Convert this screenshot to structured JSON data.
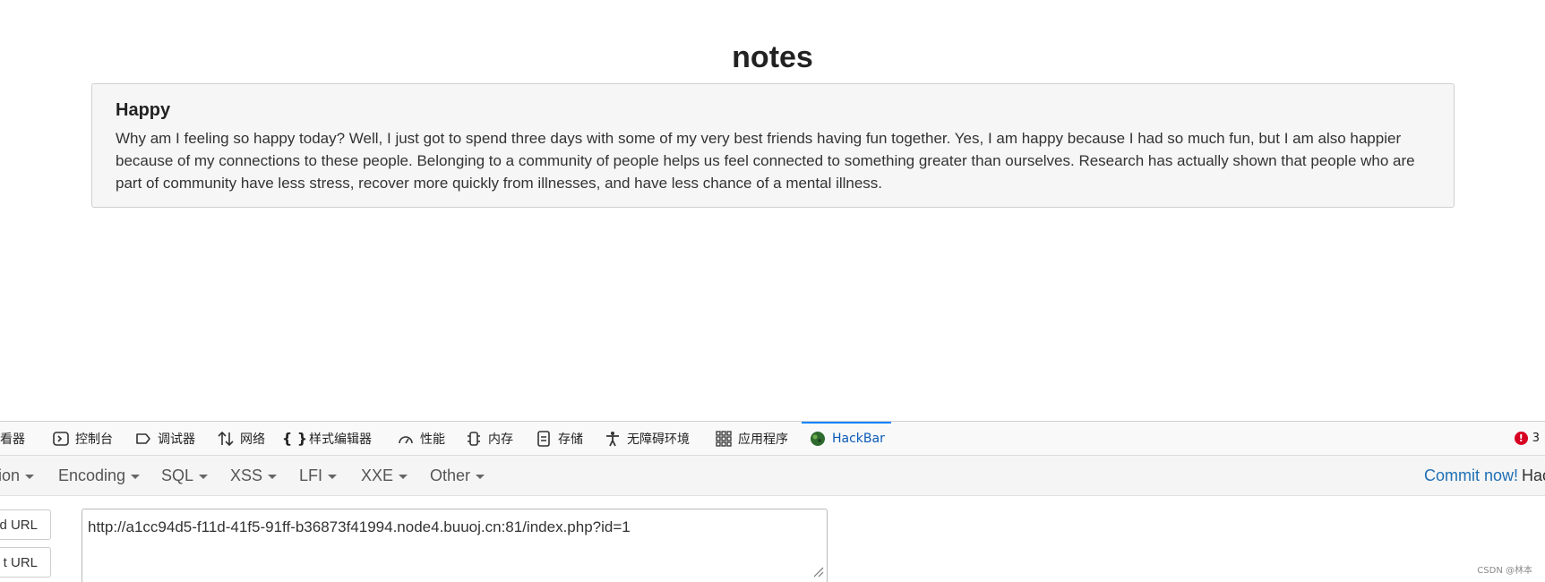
{
  "page": {
    "title": "notes",
    "note": {
      "title": "Happy",
      "body": "Why am I feeling so happy today? Well, I just got to spend three days with some of my very best friends having fun together. Yes, I am happy because I had so much fun, but I am also happier because of my connections to these people. Belonging to a community of people helps us feel connected to something greater than ourselves. Research has actually shown that people who are part of community have less stress, recover more quickly from illnesses, and have less chance of a mental illness."
    }
  },
  "devtools": {
    "tabs": [
      {
        "label": "查看器",
        "icon": "inspector-icon"
      },
      {
        "label": "控制台",
        "icon": "console-icon"
      },
      {
        "label": "调试器",
        "icon": "debugger-icon"
      },
      {
        "label": "网络",
        "icon": "network-icon"
      },
      {
        "label": "样式编辑器",
        "icon": "style-editor-icon"
      },
      {
        "label": "性能",
        "icon": "performance-icon"
      },
      {
        "label": "内存",
        "icon": "memory-icon"
      },
      {
        "label": "存储",
        "icon": "storage-icon"
      },
      {
        "label": "无障碍环境",
        "icon": "accessibility-icon"
      },
      {
        "label": "应用程序",
        "icon": "application-icon"
      },
      {
        "label": "HackBar",
        "icon": "hackbar-icon",
        "active": true
      }
    ],
    "error_count": "3",
    "accent_color": "#0a84ff",
    "error_color": "#d70022"
  },
  "hackbar": {
    "menu": [
      "ion",
      "Encoding",
      "SQL",
      "XSS",
      "LFI",
      "XXE",
      "Other"
    ],
    "commit_link": "Commit now!",
    "commit_suffix": "Hac",
    "load_url_label": "d URL",
    "split_url_label": "t URL",
    "url_value": "http://a1cc94d5-f11d-41f5-91ff-b36873f41994.node4.buuoj.cn:81/index.php?id=1"
  },
  "watermark": "CSDN @林本"
}
